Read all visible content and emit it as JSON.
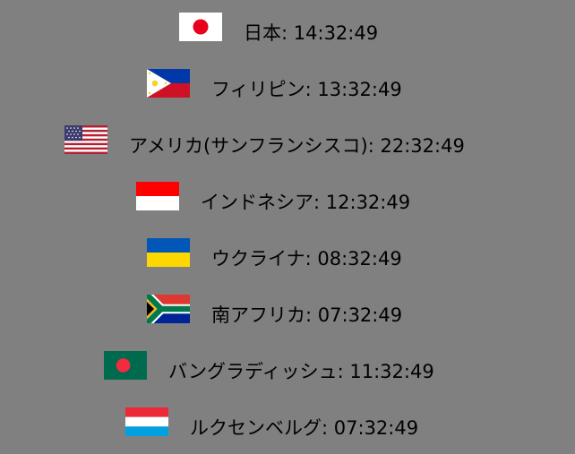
{
  "clocks": [
    {
      "flag": "japan-flag",
      "country": "日本",
      "time": "14:32:49"
    },
    {
      "flag": "philippines-flag",
      "country": "フィリピン",
      "time": "13:32:49"
    },
    {
      "flag": "usa-flag",
      "country": "アメリカ(サンフランシスコ)",
      "time": "22:32:49"
    },
    {
      "flag": "indonesia-flag",
      "country": "インドネシア",
      "time": "12:32:49"
    },
    {
      "flag": "ukraine-flag",
      "country": "ウクライナ",
      "time": "08:32:49"
    },
    {
      "flag": "south-africa-flag",
      "country": "南アフリカ",
      "time": "07:32:49"
    },
    {
      "flag": "bangladesh-flag",
      "country": "バングラディッシュ",
      "time": "11:32:49"
    },
    {
      "flag": "luxembourg-flag",
      "country": "ルクセンベルグ",
      "time": "07:32:49"
    }
  ],
  "colors": {
    "background": "#808080",
    "text": "#000000"
  }
}
